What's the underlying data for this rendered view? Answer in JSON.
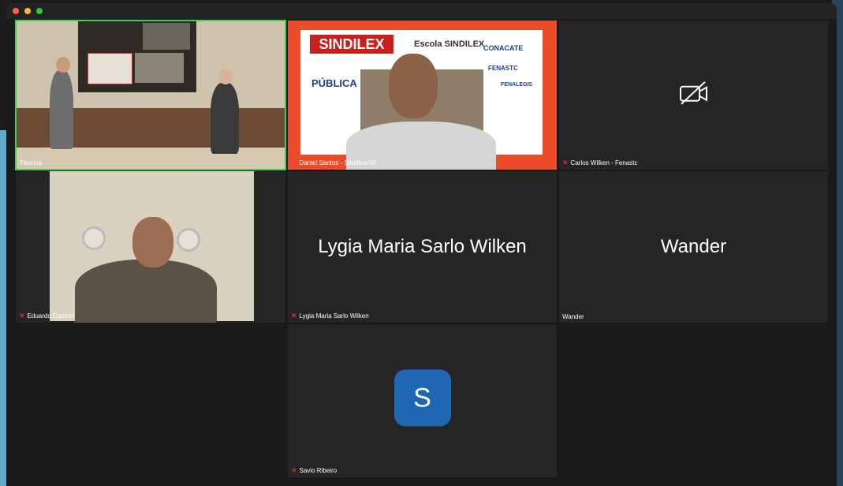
{
  "participants": [
    {
      "name": "Técnica"
    },
    {
      "name": "Daniel Santos - Sindilex/SP"
    },
    {
      "name": "Carlos Wilken - Fenastc"
    },
    {
      "name": "Eduardo Carrion"
    },
    {
      "name": "Lygia Maria Sarlo Wilken"
    },
    {
      "name": "Wander"
    },
    {
      "name": "Savio Ribeiro",
      "avatar_letter": "S"
    }
  ],
  "sindilex_banner": {
    "logo": "SINDILEX",
    "escola": "Escola SINDILEX",
    "publica": "PÚBLICA",
    "conacate": "CONACATE",
    "fenastc": "FENASTC",
    "fenalegis": "FENALEGIS"
  },
  "colors": {
    "active_speaker": "#3fd05b",
    "mic_muted": "#ff3b30",
    "avatar_bg": "#1f66b3"
  },
  "icons": {
    "camera_off": "camera-off-icon",
    "mic_muted": "mic-muted-icon"
  }
}
